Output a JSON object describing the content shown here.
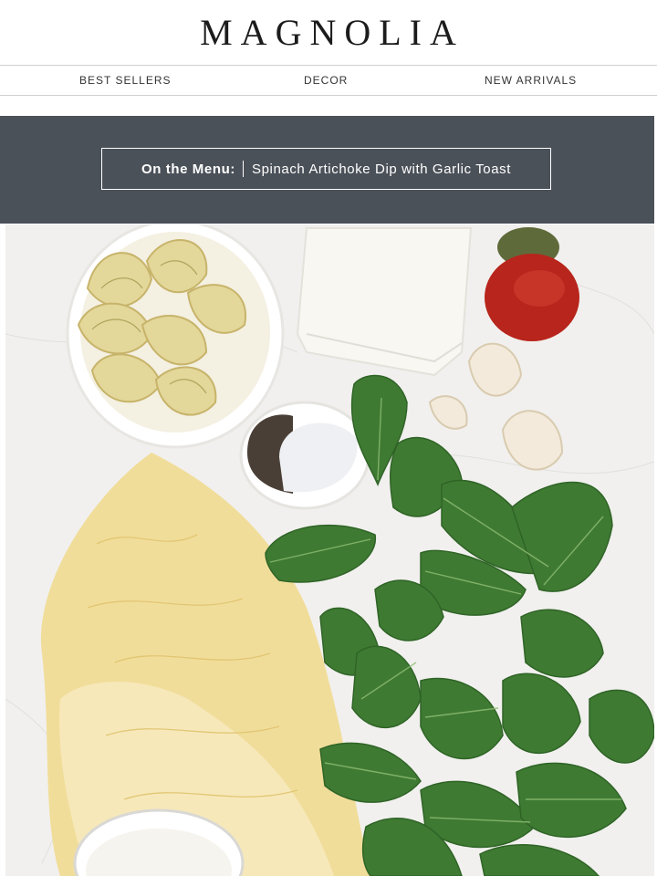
{
  "brand": {
    "logo_text": "MAGNOLIA"
  },
  "nav": {
    "items": [
      {
        "label": "BEST SELLERS"
      },
      {
        "label": "DECOR"
      },
      {
        "label": "NEW ARRIVALS"
      }
    ]
  },
  "banner": {
    "label": "On the Menu:",
    "title": "Spinach Artichoke Dip with Garlic Toast"
  },
  "hero": {
    "colors": {
      "marble": "#f1f0ee",
      "spinach": "#3f7a33",
      "cheese": "#f1dd9a",
      "paprika": "#b8251c",
      "cream_cheese": "#f8f7f2",
      "artichoke": "#e3d79a"
    }
  }
}
